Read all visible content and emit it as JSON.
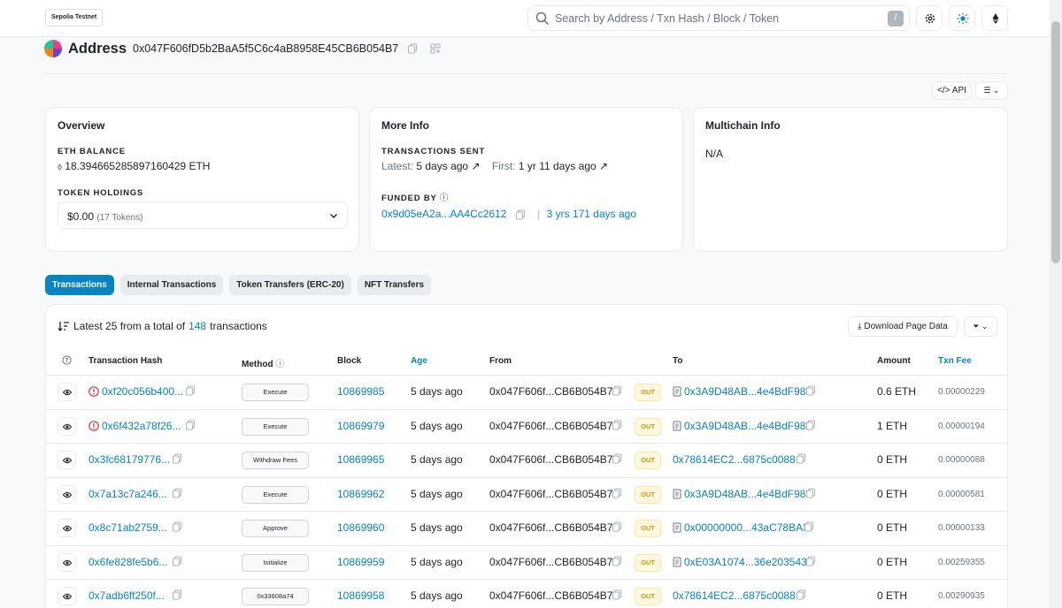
{
  "network": "Sepolia Testnet",
  "search": {
    "placeholder": "Search by Address / Txn Hash / Block / Token",
    "shortcut": "/"
  },
  "address": {
    "label": "Address",
    "hash": "0x047F606fD5b2BaA5f5C6c4aB8958E45CB6B054B7"
  },
  "toolbar": {
    "api": "API"
  },
  "overview": {
    "title": "Overview",
    "eth_balance_label": "ETH BALANCE",
    "eth_balance": "18.394665285897160429 ETH",
    "token_holdings_label": "TOKEN HOLDINGS",
    "token_value": "$0.00",
    "token_count": "(17 Tokens)"
  },
  "more_info": {
    "title": "More Info",
    "tx_sent_label": "TRANSACTIONS SENT",
    "latest_label": "Latest:",
    "latest_value": "5 days ago",
    "first_label": "First:",
    "first_value": "1 yr 11 days ago",
    "funded_label": "FUNDED BY",
    "funded_addr": "0x9d05eA2a...AA4Cc2612",
    "funded_sep": "|",
    "funded_age": "3 yrs 171 days ago"
  },
  "multichain": {
    "title": "Multichain Info",
    "value": "N/A"
  },
  "tabs": [
    "Transactions",
    "Internal Transactions",
    "Token Transfers (ERC-20)",
    "NFT Transfers"
  ],
  "summary": {
    "prefix": "Latest 25 from a total of",
    "count": "148",
    "suffix": "transactions"
  },
  "download_label": "Download Page Data",
  "columns": {
    "hash": "Transaction Hash",
    "method": "Method",
    "block": "Block",
    "age": "Age",
    "from": "From",
    "to": "To",
    "amount": "Amount",
    "fee": "Txn Fee"
  },
  "accent": "#0784c3",
  "rows": [
    {
      "error": true,
      "hash": "0xf20c056b400...",
      "method": "Execute",
      "block": "10869985",
      "age": "5 days ago",
      "from": "0x047F606f...CB6B054B7",
      "dir": "OUT",
      "contract": true,
      "to": "0x3A9D48AB...4e4BdF98b",
      "amount": "0.6 ETH",
      "fee": "0.00000229"
    },
    {
      "error": true,
      "hash": "0x6f432a78f26...",
      "method": "Execute",
      "block": "10869979",
      "age": "5 days ago",
      "from": "0x047F606f...CB6B054B7",
      "dir": "OUT",
      "contract": true,
      "to": "0x3A9D48AB...4e4BdF98b",
      "amount": "1 ETH",
      "fee": "0.00000194"
    },
    {
      "error": false,
      "hash": "0x3fc68179776...",
      "method": "Withdraw Fees",
      "block": "10869965",
      "age": "5 days ago",
      "from": "0x047F606f...CB6B054B7",
      "dir": "OUT",
      "contract": false,
      "to": "0x78614EC2...6875c0088",
      "amount": "0 ETH",
      "fee": "0.00000088"
    },
    {
      "error": false,
      "hash": "0x7a13c7a246...",
      "method": "Execute",
      "block": "10869962",
      "age": "5 days ago",
      "from": "0x047F606f...CB6B054B7",
      "dir": "OUT",
      "contract": true,
      "to": "0x3A9D48AB...4e4BdF98b",
      "amount": "0 ETH",
      "fee": "0.00000581"
    },
    {
      "error": false,
      "hash": "0x8c71ab2759...",
      "method": "Approve",
      "block": "10869960",
      "age": "5 days ago",
      "from": "0x047F606f...CB6B054B7",
      "dir": "OUT",
      "contract": true,
      "to": "0x00000000...43aC78BA3",
      "amount": "0 ETH",
      "fee": "0.00000133"
    },
    {
      "error": false,
      "hash": "0x6fe828fe5b6...",
      "method": "Initialize",
      "block": "10869959",
      "age": "5 days ago",
      "from": "0x047F606f...CB6B054B7",
      "dir": "OUT",
      "contract": true,
      "to": "0xE03A1074...36e203543",
      "amount": "0 ETH",
      "fee": "0.00259355"
    },
    {
      "error": false,
      "hash": "0x7adb6ff250f...",
      "method": "0x33608a74",
      "block": "10869958",
      "age": "5 days ago",
      "from": "0x047F606f...CB6B054B7",
      "dir": "OUT",
      "contract": false,
      "to": "0x78614EC2...6875c0088",
      "amount": "0 ETH",
      "fee": "0.00290935"
    }
  ]
}
